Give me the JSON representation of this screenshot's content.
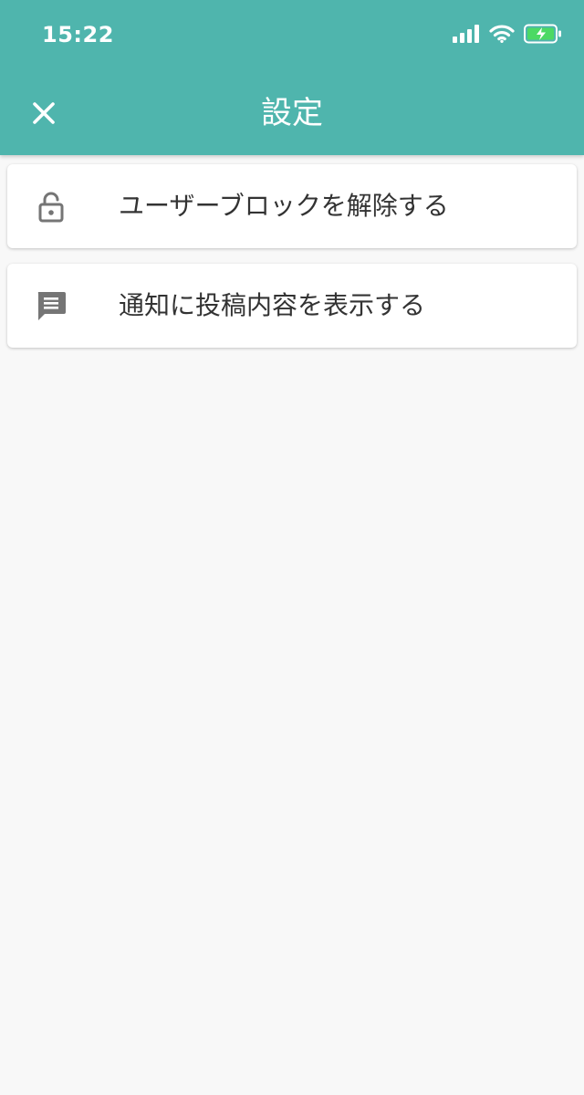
{
  "status_bar": {
    "time": "15:22",
    "icons": [
      "signal-icon",
      "wifi-icon",
      "battery-charging-icon"
    ]
  },
  "header": {
    "title": "設定",
    "close_icon": "close-icon",
    "background_color": "#4fb5ad"
  },
  "menu": {
    "items": [
      {
        "icon": "unlock-icon",
        "label": "ユーザーブロックを解除する"
      },
      {
        "icon": "message-icon",
        "label": "通知に投稿内容を表示する"
      }
    ]
  },
  "colors": {
    "accent": "#4fb5ad",
    "background": "#f8f8f8",
    "card": "#ffffff",
    "icon": "#757575",
    "text": "#333333"
  }
}
